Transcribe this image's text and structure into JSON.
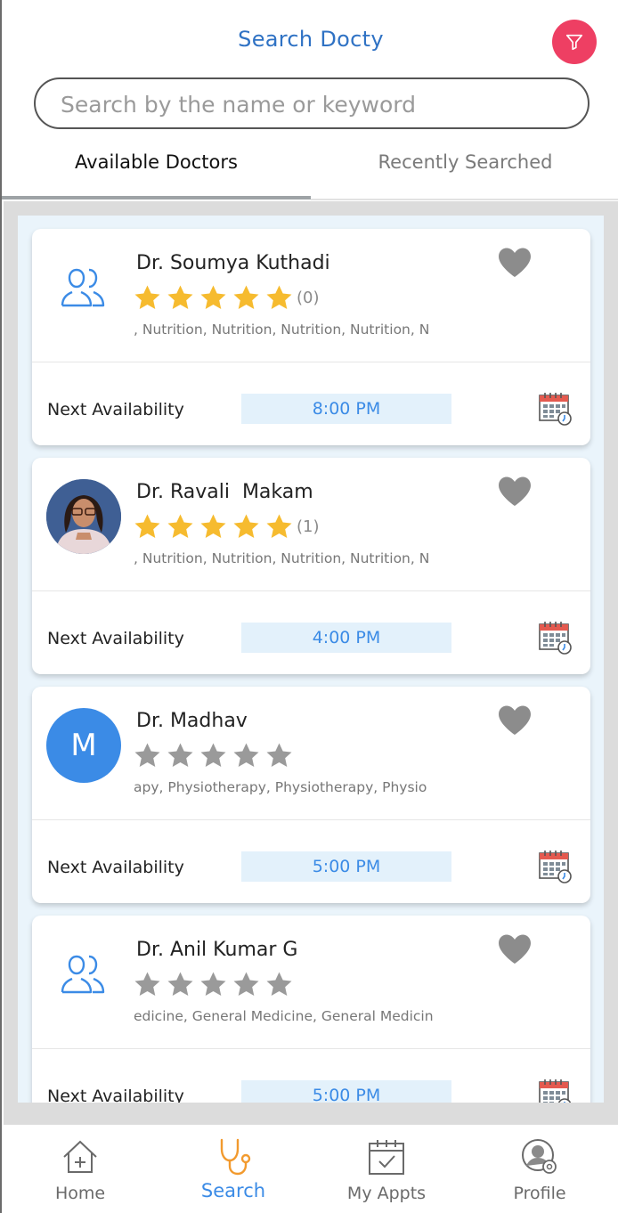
{
  "header": {
    "title": "Search Docty",
    "filter_icon": "filter-icon",
    "accent_color": "#ee3f63",
    "title_color": "#2f72c4"
  },
  "search": {
    "placeholder": "Search by the name or keyword",
    "value": ""
  },
  "tabs": [
    {
      "label": "Available Doctors",
      "active": true
    },
    {
      "label": "Recently Searched",
      "active": false
    }
  ],
  "doctors": [
    {
      "name": "Dr. Soumya Kuthadi",
      "avatar": "group-icon",
      "rating_stars": 5,
      "rating_count": "(0)",
      "specialties": ", Nutrition, Nutrition, Nutrition, Nutrition, N",
      "next_label": "Next Availability",
      "time": "8:00 PM"
    },
    {
      "name": "Dr. Ravali  Makam",
      "avatar": "photo",
      "rating_stars": 5,
      "rating_count": "(1)",
      "specialties": ", Nutrition, Nutrition, Nutrition, Nutrition, N",
      "next_label": "Next Availability",
      "time": "4:00 PM"
    },
    {
      "name": "Dr. Madhav",
      "avatar": "letter",
      "avatar_letter": "M",
      "rating_stars": 0,
      "rating_count": "",
      "specialties": "apy, Physiotherapy, Physiotherapy, Physio",
      "next_label": "Next Availability",
      "time": "5:00 PM"
    },
    {
      "name": "Dr. Anil Kumar G",
      "avatar": "group-icon",
      "rating_stars": 0,
      "rating_count": "",
      "specialties": "edicine, General Medicine, General Medicin",
      "next_label": "Next Availability",
      "time": "5:00 PM"
    }
  ],
  "bottom_nav": [
    {
      "label": "Home",
      "icon": "home-icon",
      "active": false
    },
    {
      "label": "Search",
      "icon": "stethoscope-icon",
      "active": true
    },
    {
      "label": "My Appts",
      "icon": "calendar-check-icon",
      "active": false
    },
    {
      "label": "Profile",
      "icon": "profile-settings-icon",
      "active": false
    }
  ],
  "colors": {
    "star_filled": "#f6bb2f",
    "star_empty": "#9a9a9a",
    "heart": "#8c8c8c",
    "brand_blue": "#3b8be6",
    "nav_active": "#f29a2e"
  }
}
